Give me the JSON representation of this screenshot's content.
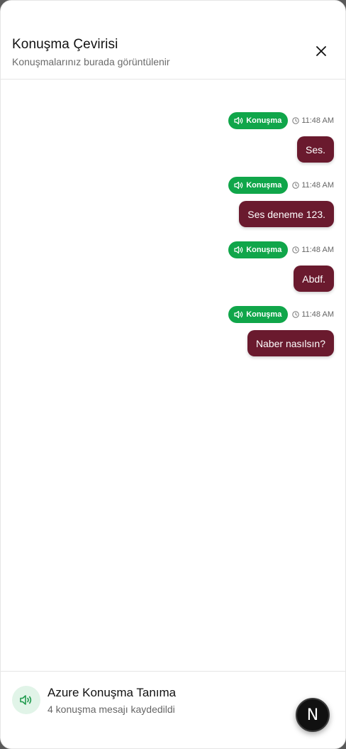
{
  "header": {
    "title": "Konuşma Çevirisi",
    "subtitle": "Konuşmalarınız burada görüntülenir",
    "close_icon": "close-icon"
  },
  "messages": [
    {
      "badge": "Konuşma",
      "time": "11:48 AM",
      "text": "Ses."
    },
    {
      "badge": "Konuşma",
      "time": "11:48 AM",
      "text": "Ses deneme 123."
    },
    {
      "badge": "Konuşma",
      "time": "11:48 AM",
      "text": "Abdf."
    },
    {
      "badge": "Konuşma",
      "time": "11:48 AM",
      "text": "Naber nasılsın?"
    }
  ],
  "footer": {
    "title": "Azure Konuşma Tanıma",
    "subtitle": "4 konuşma mesajı kaydedildi",
    "icon": "speaker-icon"
  },
  "floating_button": {
    "label": "N"
  },
  "colors": {
    "badge": "#10a64a",
    "bubble": "#6a1a2e",
    "footer_icon_bg": "#e1f4e8"
  }
}
